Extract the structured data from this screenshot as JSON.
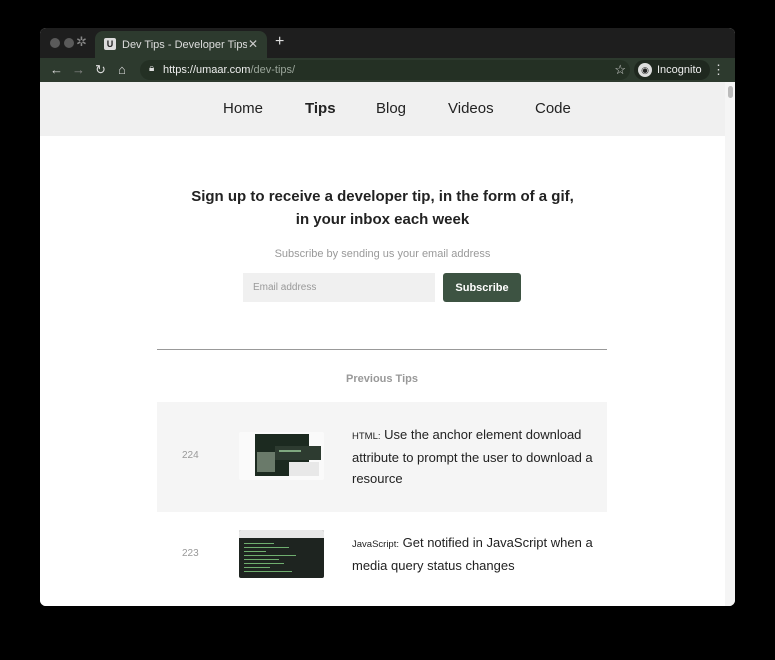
{
  "browser": {
    "tab_title": "Dev Tips - Developer Tips by",
    "favicon_letter": "U",
    "url_host": "https://umaar.com",
    "url_path": "/dev-tips/",
    "profile_label": "Incognito"
  },
  "nav": {
    "items": [
      {
        "label": "Home"
      },
      {
        "label": "Tips",
        "active": true
      },
      {
        "label": "Blog"
      },
      {
        "label": "Videos"
      },
      {
        "label": "Code"
      }
    ]
  },
  "signup": {
    "title": "Sign up to receive a developer tip, in the form of a gif, in your inbox each week",
    "subtitle": "Subscribe by sending us your email address",
    "email_placeholder": "Email address",
    "button_label": "Subscribe"
  },
  "previous": {
    "heading": "Previous Tips",
    "tips": [
      {
        "number": "224",
        "language": "HTML:",
        "text": "Use the anchor element download attribute to prompt the user to download a resource"
      },
      {
        "number": "223",
        "language": "JavaScript:",
        "text": "Get notified in JavaScript when a media query status changes"
      }
    ]
  },
  "colors": {
    "accent": "#3d5342",
    "browser_chrome": "#2d3a2e",
    "nav_bg": "#f0f0f0"
  }
}
